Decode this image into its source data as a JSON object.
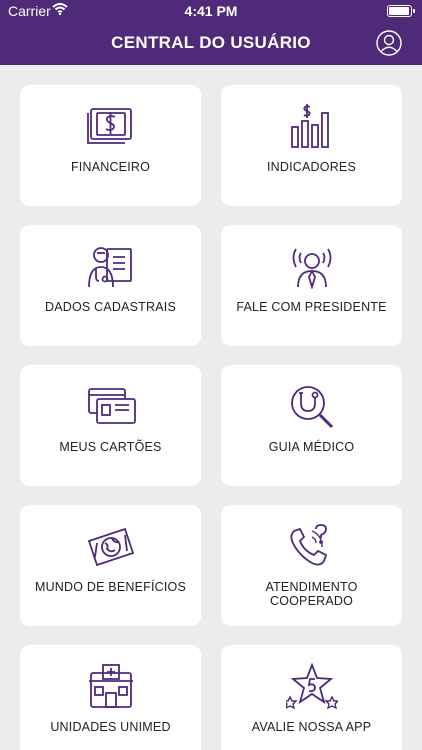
{
  "status_bar": {
    "carrier": "Carrier",
    "time": "4:41 PM"
  },
  "header": {
    "title": "CENTRAL DO USUÁRIO",
    "profile_icon": "user-circle-icon"
  },
  "colors": {
    "brand": "#4e2a79",
    "background": "#ececec",
    "tile": "#ffffff"
  },
  "tiles": [
    {
      "label": "FINANCEIRO",
      "icon": "money-icon"
    },
    {
      "label": "INDICADORES",
      "icon": "bar-chart-dollar-icon"
    },
    {
      "label": "DADOS CADASTRAIS",
      "icon": "doctor-id-icon"
    },
    {
      "label": "FALE COM PRESIDENTE",
      "icon": "president-icon"
    },
    {
      "label": "MEUS CARTÕES",
      "icon": "cards-icon"
    },
    {
      "label": "GUIA MÉDICO",
      "icon": "stethoscope-search-icon"
    },
    {
      "label": "MUNDO DE BENEFÍCIOS",
      "icon": "world-benefits-icon"
    },
    {
      "label": "ATENDIMENTO\nCOOPERADO",
      "icon": "phone-question-icon"
    },
    {
      "label": "UNIDADES UNIMED",
      "icon": "hospital-icon"
    },
    {
      "label": "AVALIE NOSSA APP",
      "icon": "star-rating-icon"
    }
  ]
}
